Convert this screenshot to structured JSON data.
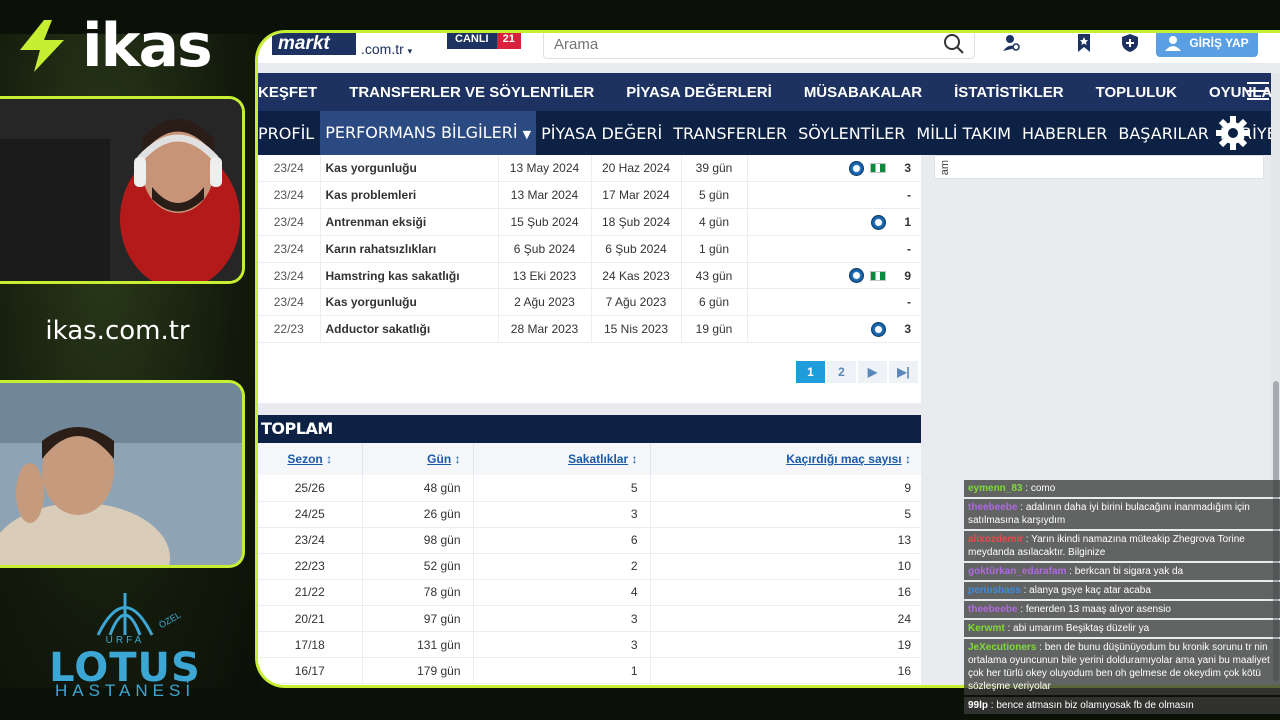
{
  "overlay": {
    "brand": "ikas",
    "site": "ikas.com.tr",
    "sponsor": {
      "top": "ÖZEL",
      "city": "URFA",
      "name": "LOTUS",
      "sub": "HASTANESİ"
    }
  },
  "site": {
    "logo": "markt",
    "domain": ".com.tr",
    "live_label": "CANLI",
    "live_count": "21",
    "search_placeholder": "Arama",
    "login_label": "GİRİŞ YAP",
    "accent": "#1d3260"
  },
  "main_nav": [
    "KEŞFET",
    "TRANSFERLER VE SÖYLENTİLER",
    "PİYASA DEĞERLERİ",
    "MÜSABAKALAR",
    "İSTATİSTİKLER",
    "TOPLULUK",
    "OYUNLAR"
  ],
  "sub_nav": [
    "PROFİL",
    "PERFORMANS BİLGİLERİ",
    "PİYASA DEĞERİ",
    "TRANSFERLER",
    "SÖYLENTİLER",
    "MİLLİ TAKIM",
    "HABERLER",
    "BAŞARILAR",
    "KARİYER"
  ],
  "injuries": [
    {
      "season": "23/24",
      "injury": "Kas yorgunluğu",
      "from": "13 May 2024",
      "until": "20 Haz 2024",
      "days": "39 gün",
      "club": true,
      "flag": true,
      "games": "3"
    },
    {
      "season": "23/24",
      "injury": "Kas problemleri",
      "from": "13 Mar 2024",
      "until": "17 Mar 2024",
      "days": "5 gün",
      "club": false,
      "flag": false,
      "games": "-"
    },
    {
      "season": "23/24",
      "injury": "Antrenman eksiği",
      "from": "15 Şub 2024",
      "until": "18 Şub 2024",
      "days": "4 gün",
      "club": true,
      "flag": false,
      "games": "1"
    },
    {
      "season": "23/24",
      "injury": "Karın rahatsızlıkları",
      "from": "6 Şub 2024",
      "until": "6 Şub 2024",
      "days": "1 gün",
      "club": false,
      "flag": false,
      "games": "-"
    },
    {
      "season": "23/24",
      "injury": "Hamstring kas sakatlığı",
      "from": "13 Eki 2023",
      "until": "24 Kas 2023",
      "days": "43 gün",
      "club": true,
      "flag": true,
      "games": "9"
    },
    {
      "season": "23/24",
      "injury": "Kas yorgunluğu",
      "from": "2 Ağu 2023",
      "until": "7 Ağu 2023",
      "days": "6 gün",
      "club": false,
      "flag": false,
      "games": "-"
    },
    {
      "season": "22/23",
      "injury": "Adductor sakatlığı",
      "from": "28 Mar 2023",
      "until": "15 Nis 2023",
      "days": "19 gün",
      "club": true,
      "flag": false,
      "games": "3"
    }
  ],
  "pager": {
    "current": "1",
    "next": "2"
  },
  "totals": {
    "title": "TOPLAM",
    "headers": [
      "Sezon",
      "Gün",
      "Sakatlıklar",
      "Kaçırdığı maç sayısı"
    ],
    "rows": [
      [
        "25/26",
        "48 gün",
        "5",
        "9"
      ],
      [
        "24/25",
        "26 gün",
        "3",
        "5"
      ],
      [
        "23/24",
        "98 gün",
        "6",
        "13"
      ],
      [
        "22/23",
        "52 gün",
        "2",
        "10"
      ],
      [
        "21/22",
        "78 gün",
        "4",
        "16"
      ],
      [
        "20/21",
        "97 gün",
        "3",
        "24"
      ],
      [
        "17/18",
        "131 gün",
        "3",
        "19"
      ],
      [
        "16/17",
        "179 gün",
        "1",
        "16"
      ]
    ]
  },
  "side_panel_text": "am",
  "chat": [
    {
      "user": "eymenn_83",
      "color": "#7ddc3a",
      "text": "como"
    },
    {
      "user": "theebeebe",
      "color": "#b06ae0",
      "text": "adalının daha iyi birini bulacağını inanmadığım için satılmasına karşıydım"
    },
    {
      "user": "alixozdemir",
      "color": "#e84a4a",
      "text": "Yarın ikindi namazına müteakip Zhegrova Torine meydanda asılacaktır. Bilginize"
    },
    {
      "user": "goktürkan_edarafam",
      "color": "#b06ae0",
      "text": "berkcan bi sigara yak da"
    },
    {
      "user": "periusbass",
      "color": "#3c8de0",
      "text": "alanya gsye kaç atar acaba"
    },
    {
      "user": "theebeebe",
      "color": "#b06ae0",
      "text": "fenerden 13 maaş alıyor asensio"
    },
    {
      "user": "Kerwmt",
      "color": "#7ddc3a",
      "text": "abi umarım Beşiktaş düzelir ya"
    },
    {
      "user": "JeXecutioners",
      "color": "#7ddc3a",
      "text": "ben de bunu düşünüyodum bu kronik sorunu tr nin ortalama oyuncunun bile yerini dolduramıyolar ama yani bu maaliyet çok her türlü okey oluyodum ben oh gelmese de okeydim çok kötü sözleşme veriyolar"
    },
    {
      "user": "99lp",
      "color": "#ffffff",
      "text": "bence atmasın biz olamıyosak fb de olmasın"
    }
  ]
}
